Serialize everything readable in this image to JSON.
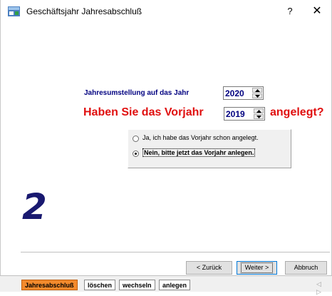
{
  "window": {
    "title": "Geschäftsjahr Jahresabschluß",
    "help_label": "?",
    "close_label": "✕"
  },
  "year_row": {
    "label": "Jahresumstellung auf das Jahr",
    "value": "2020"
  },
  "question": {
    "text_before": "Haben Sie das Vorjahr",
    "previous_year": "2019",
    "text_after": "angelegt?"
  },
  "options": [
    {
      "label": "Ja, ich habe das Vorjahr schon angelegt.",
      "checked": false
    },
    {
      "label": "Nein, bitte jetzt das Vorjahr anlegen.",
      "checked": true
    }
  ],
  "step_number": "2",
  "buttons": {
    "back": "< Zurück",
    "next": "Weiter >",
    "cancel": "Abbruch"
  },
  "tabs": [
    {
      "label": "Jahresabschluß",
      "active": true
    },
    {
      "label": "löschen",
      "active": false
    },
    {
      "label": "wechseln",
      "active": false
    },
    {
      "label": "anlegen",
      "active": false
    }
  ],
  "tab_nav": "◁ ▷",
  "colors": {
    "question_red": "#e01010",
    "label_navy": "#000080",
    "step_number": "#191970",
    "active_tab": "#f28a2c"
  }
}
